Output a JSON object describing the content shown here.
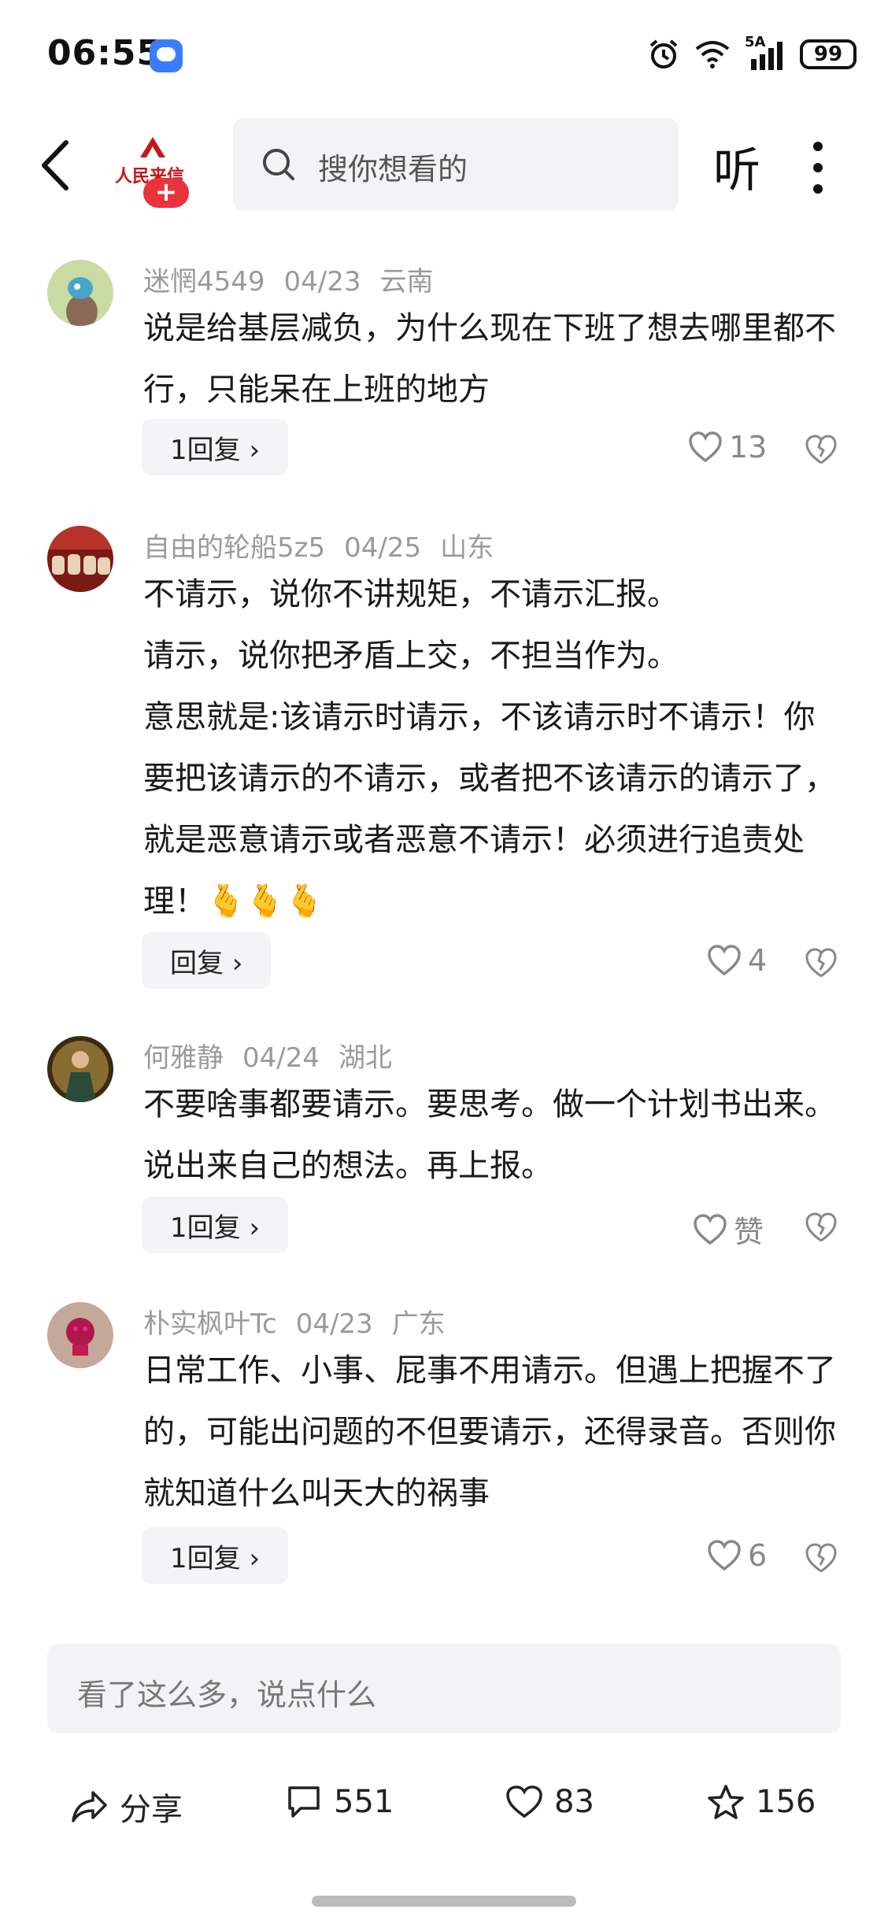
{
  "status_bar": {
    "time": "06:55",
    "signal_label": "5A",
    "battery": "99"
  },
  "header": {
    "logo_text": "人民来信",
    "logo_plus": "+",
    "search_placeholder": "搜你想看的",
    "listen_label": "听"
  },
  "comments": [
    {
      "user": "迷惘4549",
      "date": "04/23",
      "region": "云南",
      "text": "说是给基层减负，为什么现在下班了想去哪里都不行，只能呆在上班的地方",
      "reply_label": "1回复 ›",
      "likes": "13"
    },
    {
      "user": "自由的轮船5z5",
      "date": "04/25",
      "region": "山东",
      "text_lines": [
        "不请示，说你不讲规矩，不请示汇报。",
        "请示，说你把矛盾上交，不担当作为。",
        "意思就是:该请示时请示，不该请示时不请示！你要把该请示的不请示，或者把不该请示的请示了，就是恶意请示或者恶意不请示！必须进行追责处理！🫰🫰🫰"
      ],
      "reply_label": "回复 ›",
      "likes": "4"
    },
    {
      "user": "何雅静",
      "date": "04/24",
      "region": "湖北",
      "text": "不要啥事都要请示。要思考。做一个计划书出来。说出来自己的想法。再上报。",
      "reply_label": "1回复 ›",
      "likes": "赞"
    },
    {
      "user": "朴实枫叶Tc",
      "date": "04/23",
      "region": "广东",
      "text": "日常工作、小事、屁事不用请示。但遇上把握不了的，可能出问题的不但要请示，还得录音。否则你就知道什么叫天大的祸事",
      "reply_label": "1回复 ›",
      "likes": "6"
    }
  ],
  "input": {
    "placeholder": "看了这么多，说点什么"
  },
  "bottom_bar": {
    "share_label": "分享",
    "comments_count": "551",
    "likes_count": "83",
    "favorites_count": "156"
  },
  "colors": {
    "accent_red": "#e8343a",
    "brand_red": "#c8161d",
    "gray_text": "#9a9a9a"
  }
}
